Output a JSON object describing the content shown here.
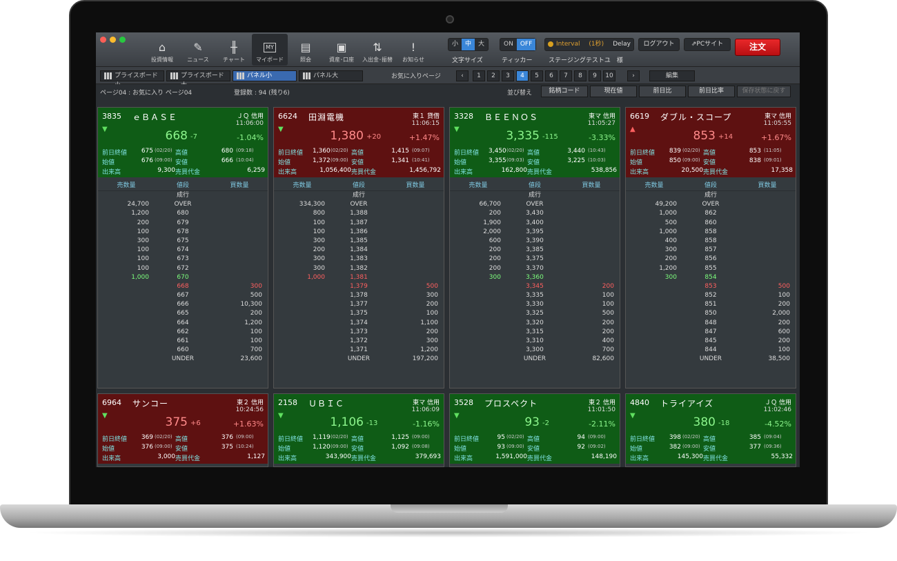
{
  "toolbar": {
    "nav": [
      {
        "label": "投資情報",
        "icon": "home-icon",
        "glyph": "⌂"
      },
      {
        "label": "ニュース",
        "icon": "news-icon",
        "glyph": "✎"
      },
      {
        "label": "チャート",
        "icon": "chart-icon",
        "glyph": "╫"
      },
      {
        "label": "マイボード",
        "icon": "myboard-icon",
        "glyph": "MY"
      },
      {
        "label": "照会",
        "icon": "book-icon",
        "glyph": "▤"
      },
      {
        "label": "資産･口座",
        "icon": "asset-icon",
        "glyph": "▣"
      },
      {
        "label": "入出金･振替",
        "icon": "transfer-icon",
        "glyph": "⇅"
      },
      {
        "label": "お知らせ",
        "icon": "notice-icon",
        "glyph": "!"
      }
    ],
    "font_sizes": [
      "小",
      "中",
      "大"
    ],
    "font_size_label": "文字サイズ",
    "ticker": [
      "ON",
      "OFF"
    ],
    "ticker_label": "ティッカー",
    "interval": "Interval",
    "interval_sec": "(1秒)",
    "delay": "Delay",
    "user_label": "ステージングテストユ　様",
    "logout": "ログアウト",
    "pc_site": "PCサイト",
    "order": "注文"
  },
  "viewbar": {
    "views": [
      "プライスボード小",
      "プライスボード大",
      "パネル小",
      "パネル大"
    ],
    "favorites_label": "お気に入りページ",
    "pages": [
      "1",
      "2",
      "3",
      "4",
      "5",
      "6",
      "7",
      "8",
      "9",
      "10"
    ],
    "prev": "‹",
    "next": "›",
    "edit": "編集"
  },
  "infobar": {
    "page": "ページ04 : お気に入り ページ04",
    "count": "登録数 : 94 (残り6)",
    "sort_label": "並び替え",
    "sort": [
      "銘柄コード",
      "現在値",
      "前日比",
      "前日比率"
    ],
    "reset": "保存状態に戻す"
  },
  "labels": {
    "prev_close": "前日終値",
    "high": "高値",
    "open": "始値",
    "low": "安値",
    "volume": "出来高",
    "turnover": "売買代金",
    "sell_qty": "売数量",
    "price": "値段",
    "buy_qty": "買数量",
    "market": "成行"
  },
  "panels": [
    {
      "code": "3835",
      "name": "ｅＢＡＳＥ",
      "market": "ＪＱ 信用",
      "time": "11:06:00",
      "dir": "down",
      "price": "668",
      "chg": "-7",
      "pct": "-1.04%",
      "prev_close": "675",
      "prev_date": "(02/20)",
      "high": "680",
      "high_t": "(09:18)",
      "open": "676",
      "open_t": "(09:00)",
      "low": "666",
      "low_t": "(10:04)",
      "volume": "9,300",
      "turnover": "6,259",
      "theme": "green",
      "book": [
        [
          "24,700",
          "OVER",
          ""
        ],
        [
          "1,200",
          "680",
          ""
        ],
        [
          "200",
          "679",
          ""
        ],
        [
          "100",
          "678",
          ""
        ],
        [
          "300",
          "675",
          ""
        ],
        [
          "100",
          "674",
          ""
        ],
        [
          "100",
          "673",
          ""
        ],
        [
          "100",
          "672",
          ""
        ],
        [
          "1,000",
          "670",
          "",
          "g"
        ],
        [
          "",
          "668",
          "300",
          "r"
        ],
        [
          "",
          "667",
          "500"
        ],
        [
          "",
          "666",
          "10,300"
        ],
        [
          "",
          "665",
          "200"
        ],
        [
          "",
          "664",
          "1,200"
        ],
        [
          "",
          "662",
          "100"
        ],
        [
          "",
          "661",
          "100"
        ],
        [
          "",
          "660",
          "700"
        ],
        [
          "",
          "UNDER",
          "23,600"
        ]
      ]
    },
    {
      "code": "6624",
      "name": "田淵電機",
      "market": "東１ 貸借",
      "time": "11:06:15",
      "dir": "down",
      "price": "1,380",
      "chg": "+20",
      "pct": "+1.47%",
      "prev_close": "1,360",
      "prev_date": "(02/20)",
      "high": "1,415",
      "high_t": "(09:07)",
      "open": "1,372",
      "open_t": "(09:00)",
      "low": "1,341",
      "low_t": "(10:41)",
      "volume": "1,056,400",
      "turnover": "1,456,792",
      "theme": "red",
      "book": [
        [
          "334,300",
          "OVER",
          ""
        ],
        [
          "800",
          "1,388",
          ""
        ],
        [
          "100",
          "1,387",
          ""
        ],
        [
          "100",
          "1,386",
          ""
        ],
        [
          "300",
          "1,385",
          ""
        ],
        [
          "200",
          "1,384",
          ""
        ],
        [
          "300",
          "1,383",
          ""
        ],
        [
          "300",
          "1,382",
          ""
        ],
        [
          "1,000",
          "1,381",
          "",
          "r"
        ],
        [
          "",
          "1,379",
          "500",
          "r"
        ],
        [
          "",
          "1,378",
          "300"
        ],
        [
          "",
          "1,377",
          "200"
        ],
        [
          "",
          "1,375",
          "100"
        ],
        [
          "",
          "1,374",
          "1,100"
        ],
        [
          "",
          "1,373",
          "200"
        ],
        [
          "",
          "1,372",
          "300"
        ],
        [
          "",
          "1,371",
          "1,200"
        ],
        [
          "",
          "UNDER",
          "197,200"
        ]
      ]
    },
    {
      "code": "3328",
      "name": "ＢＥＥＮＯＳ",
      "market": "東マ 信用",
      "time": "11:05:27",
      "dir": "down",
      "price": "3,335",
      "chg": "-115",
      "pct": "-3.33%",
      "prev_close": "3,450",
      "prev_date": "(02/20)",
      "high": "3,440",
      "high_t": "(10:43)",
      "open": "3,355",
      "open_t": "(09:03)",
      "low": "3,225",
      "low_t": "(10:03)",
      "volume": "162,800",
      "turnover": "538,856",
      "theme": "green",
      "book": [
        [
          "66,700",
          "OVER",
          ""
        ],
        [
          "200",
          "3,430",
          ""
        ],
        [
          "1,900",
          "3,400",
          ""
        ],
        [
          "2,000",
          "3,395",
          ""
        ],
        [
          "600",
          "3,390",
          ""
        ],
        [
          "200",
          "3,385",
          ""
        ],
        [
          "200",
          "3,375",
          ""
        ],
        [
          "200",
          "3,370",
          ""
        ],
        [
          "300",
          "3,360",
          "",
          "g"
        ],
        [
          "",
          "3,345",
          "200",
          "r"
        ],
        [
          "",
          "3,335",
          "100"
        ],
        [
          "",
          "3,330",
          "100"
        ],
        [
          "",
          "3,325",
          "500"
        ],
        [
          "",
          "3,320",
          "200"
        ],
        [
          "",
          "3,315",
          "200"
        ],
        [
          "",
          "3,310",
          "400"
        ],
        [
          "",
          "3,300",
          "700"
        ],
        [
          "",
          "UNDER",
          "82,600"
        ]
      ]
    },
    {
      "code": "6619",
      "name": "ダブル・スコープ",
      "market": "東マ 信用",
      "time": "11:05:55",
      "dir": "up",
      "price": "853",
      "chg": "+14",
      "pct": "+1.67%",
      "prev_close": "839",
      "prev_date": "(02/20)",
      "high": "853",
      "high_t": "(11:05)",
      "open": "850",
      "open_t": "(09:00)",
      "low": "838",
      "low_t": "(09:01)",
      "volume": "20,500",
      "turnover": "17,358",
      "theme": "red",
      "book": [
        [
          "49,200",
          "OVER",
          ""
        ],
        [
          "1,000",
          "862",
          ""
        ],
        [
          "500",
          "860",
          ""
        ],
        [
          "1,000",
          "858",
          ""
        ],
        [
          "400",
          "858",
          ""
        ],
        [
          "300",
          "857",
          ""
        ],
        [
          "200",
          "856",
          ""
        ],
        [
          "1,200",
          "855",
          ""
        ],
        [
          "300",
          "854",
          "",
          "g"
        ],
        [
          "",
          "853",
          "500",
          "r"
        ],
        [
          "",
          "852",
          "100"
        ],
        [
          "",
          "851",
          "200"
        ],
        [
          "",
          "850",
          "2,000"
        ],
        [
          "",
          "848",
          "200"
        ],
        [
          "",
          "847",
          "600"
        ],
        [
          "",
          "845",
          "200"
        ],
        [
          "",
          "844",
          "100"
        ],
        [
          "",
          "UNDER",
          "38,500"
        ]
      ]
    },
    {
      "code": "6964",
      "name": "サンコー",
      "market": "東２ 信用",
      "time": "10:24:56",
      "dir": "down",
      "price": "375",
      "chg": "+6",
      "pct": "+1.63%",
      "prev_close": "369",
      "prev_date": "(02/20)",
      "high": "376",
      "high_t": "(09:00)",
      "open": "376",
      "open_t": "(09:00)",
      "low": "375",
      "low_t": "(10:24)",
      "volume": "3,000",
      "turnover": "1,127",
      "theme": "red"
    },
    {
      "code": "2158",
      "name": "ＵＢＩＣ",
      "market": "東マ 信用",
      "time": "11:06:09",
      "dir": "down",
      "price": "1,106",
      "chg": "-13",
      "pct": "-1.16%",
      "prev_close": "1,119",
      "prev_date": "(02/20)",
      "high": "1,125",
      "high_t": "(09:00)",
      "open": "1,120",
      "open_t": "(09:00)",
      "low": "1,092",
      "low_t": "(09:08)",
      "volume": "343,900",
      "turnover": "379,693",
      "theme": "green"
    },
    {
      "code": "3528",
      "name": "プロスペクト",
      "market": "東２ 信用",
      "time": "11:01:50",
      "dir": "down",
      "price": "93",
      "chg": "-2",
      "pct": "-2.11%",
      "prev_close": "95",
      "prev_date": "(02/20)",
      "high": "94",
      "high_t": "(09:00)",
      "open": "93",
      "open_t": "(09:00)",
      "low": "92",
      "low_t": "(09:02)",
      "volume": "1,591,000",
      "turnover": "148,190",
      "theme": "green"
    },
    {
      "code": "4840",
      "name": "トライアイズ",
      "market": "ＪＱ 信用",
      "time": "11:02:46",
      "dir": "down",
      "price": "380",
      "chg": "-18",
      "pct": "-4.52%",
      "prev_close": "398",
      "prev_date": "(02/20)",
      "high": "385",
      "high_t": "(09:04)",
      "open": "382",
      "open_t": "(09:00)",
      "low": "377",
      "low_t": "(09:36)",
      "volume": "145,300",
      "turnover": "55,332",
      "theme": "green"
    }
  ]
}
